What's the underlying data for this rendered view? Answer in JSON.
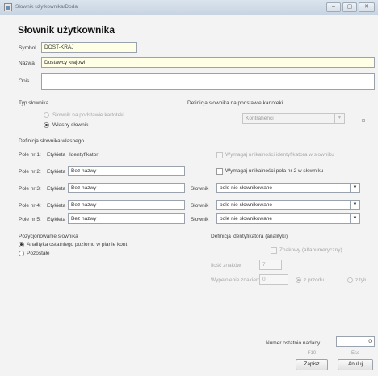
{
  "window": {
    "title": "Słownik użytkownika/Dodaj",
    "min_glyph": "‒",
    "max_glyph": "▢",
    "close_glyph": "✕"
  },
  "heading": "Słownik użytkownika",
  "form": {
    "symbol_label": "Symbol",
    "symbol_value": "DOST-KRAJ",
    "name_label": "Nazwa",
    "name_value": "Dostawcy krajowi",
    "desc_label": "Opis",
    "desc_value": ""
  },
  "type_section": {
    "title": "Typ słownika",
    "option_card": "Słownik na podstawie kartoteki",
    "option_own": "Własny słownik",
    "selected": "own"
  },
  "card_def": {
    "title": "Definicja słownika na podstawie kartoteki",
    "combo_value": "Kontrahenci"
  },
  "own_def": {
    "title": "Definicja słownika własnego",
    "fields": [
      {
        "label": "Pole nr 1:",
        "etykieta": "Etykieta",
        "value": "Identyfikator"
      },
      {
        "label": "Pole nr 2:",
        "etykieta": "Etykieta",
        "value": "Bez nazwy"
      },
      {
        "label": "Pole nr 3:",
        "etykieta": "Etykieta",
        "value": "Bez nazwy"
      },
      {
        "label": "Pole nr 4:",
        "etykieta": "Etykieta",
        "value": "Bez nazwy"
      },
      {
        "label": "Pole nr 5:",
        "etykieta": "Etykieta",
        "value": "Bez nazwy"
      }
    ],
    "check_unique_id": "Wymagaj unikalności identyfikatora w słowniku",
    "check_unique_field2": "Wymagaj unikalności pola nr 2 w słowniku",
    "slownik_label": "Słownik",
    "slownik_value": "pole nie słownikowane"
  },
  "position_section": {
    "title": "Pozycjonowanie słownika",
    "option_analytics": "Analityka ostatniego poziomu w planie kont",
    "option_other": "Pozostałe",
    "selected": "analytics"
  },
  "id_def": {
    "title": "Definicja identyfikatora (analityki)",
    "check_numeric": "Znakowy (alfanumeryczny)",
    "char_count_label": "Ilość znaków",
    "char_count_value": "7",
    "fill_label": "Wypełnienie znakiem",
    "fill_value": "0",
    "from_front": "z przodu",
    "from_back": "z tyłu"
  },
  "footer": {
    "last_number_label": "Numer ostatnio nadany",
    "last_number_value": "0",
    "f10": "F10",
    "esc": "Esc",
    "save_label": "Zapisz",
    "cancel_label": "Anuluj"
  }
}
